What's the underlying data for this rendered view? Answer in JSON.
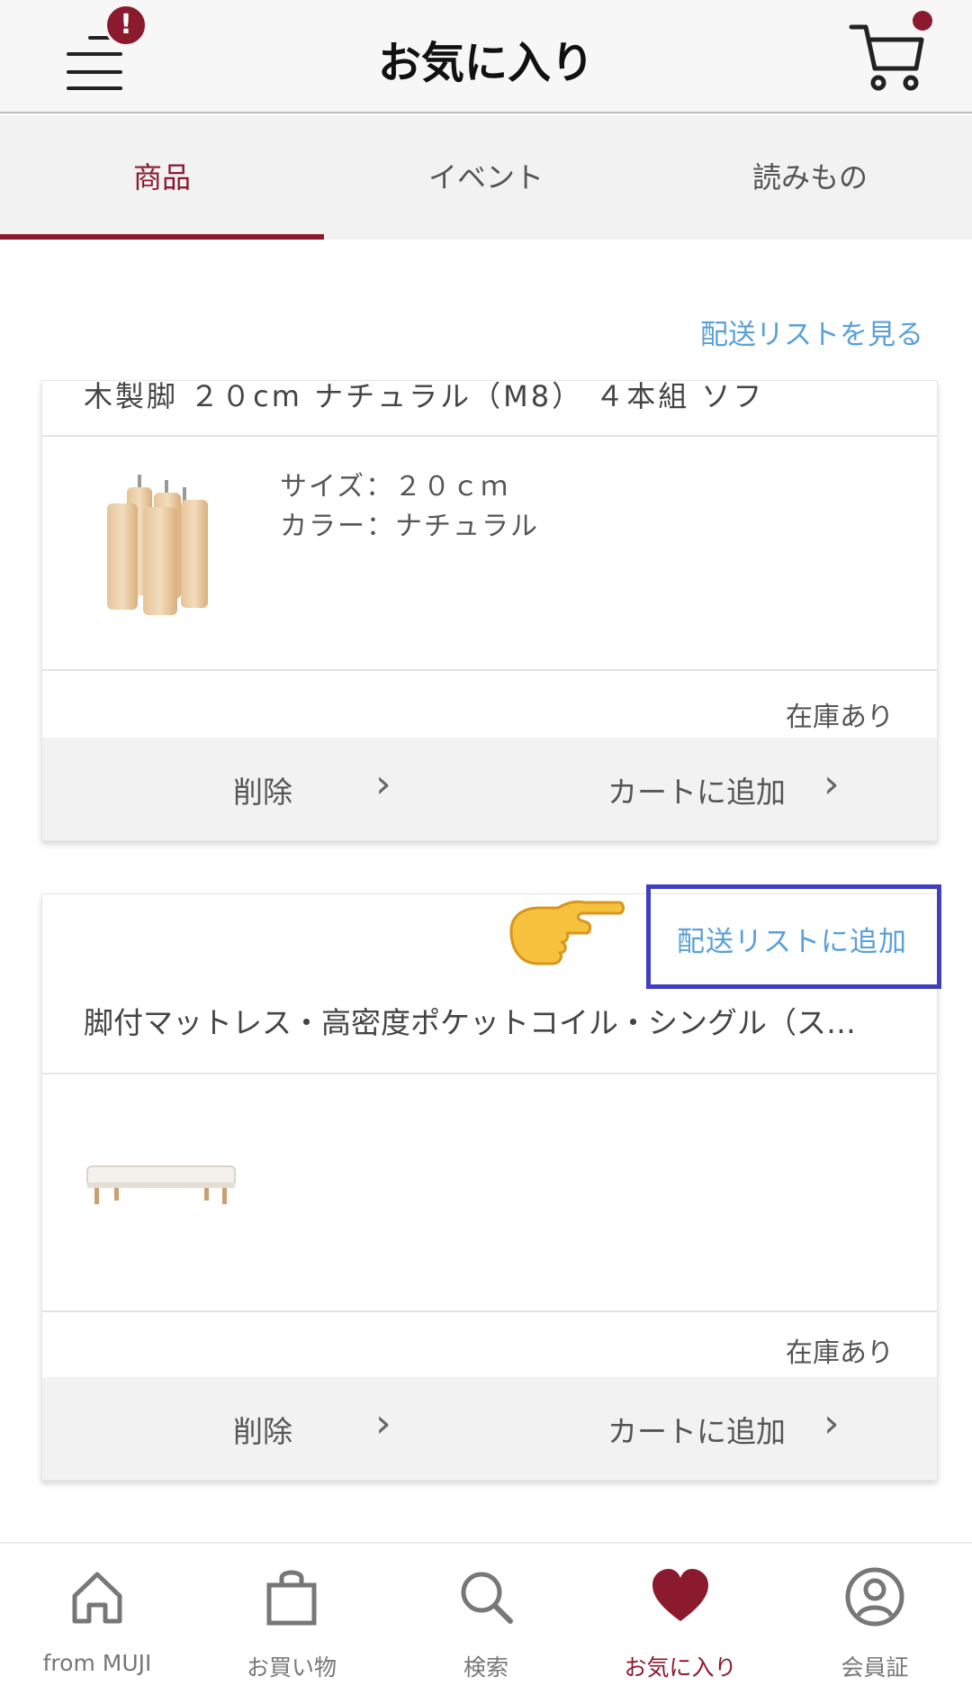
{
  "header": {
    "title": "お気に入り",
    "menu_badge": "!",
    "menu_icon": "hamburger-menu-icon",
    "cart_icon": "cart-icon"
  },
  "tabs": [
    {
      "label": "商品",
      "active": true
    },
    {
      "label": "イベント",
      "active": false
    },
    {
      "label": "読みもの",
      "active": false
    }
  ],
  "top_link": "配送リストを見る",
  "items": [
    {
      "title_cut": "木製脚 ２０cm ナチュラル（M8） ４本組 ソフ",
      "size": "サイズ：２０ｃｍ",
      "color": "カラー：ナチュラル",
      "stock": "在庫あり",
      "delete": "削除",
      "add_cart": "カートに追加"
    },
    {
      "add_list": "配送リストに追加",
      "title": "脚付マットレス・高密度ポケットコイル・シングル（ス…",
      "stock": "在庫あり",
      "delete": "削除",
      "add_cart": "カートに追加"
    }
  ],
  "bottom_nav": [
    {
      "label": "from MUJI",
      "icon": "home-icon"
    },
    {
      "label": "お買い物",
      "icon": "shopping-bag-icon"
    },
    {
      "label": "検索",
      "icon": "search-icon"
    },
    {
      "label": "お気に入り",
      "icon": "heart-icon",
      "active": true
    },
    {
      "label": "会員証",
      "icon": "member-icon"
    }
  ],
  "colors": {
    "accent": "#8b1a2e",
    "link": "#5aa0d8",
    "highlight_box": "#3f3fbf"
  }
}
